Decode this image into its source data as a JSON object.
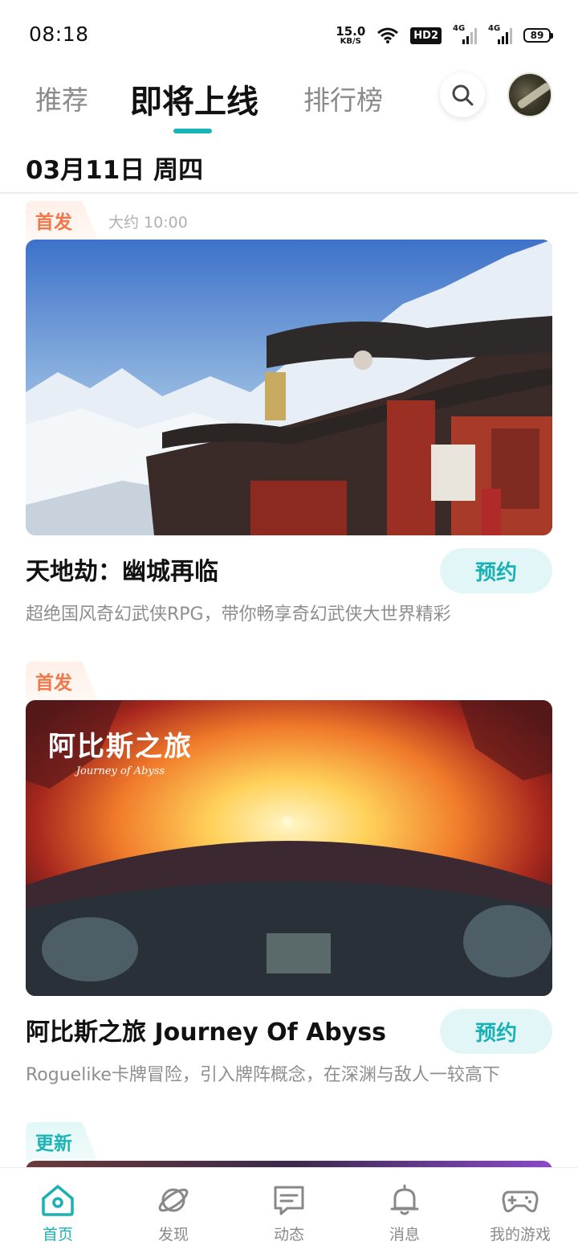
{
  "status_bar": {
    "time": "08:18",
    "net_speed_value": "15.0",
    "net_speed_unit": "KB/S",
    "hd_label": "HD2",
    "sig1_label": "4G",
    "sig2_label": "4G",
    "battery": "89"
  },
  "top_nav": {
    "tabs": [
      {
        "label": "推荐"
      },
      {
        "label": "即将上线"
      },
      {
        "label": "排行榜"
      }
    ],
    "active_tab": "即将上线"
  },
  "date_header": "03月11日 周四",
  "feed": [
    {
      "badge": "首发",
      "time_note": "大约 10:00",
      "title": "天地劫：幽城再临",
      "button": "预约",
      "description": "超绝国风奇幻武侠RPG，带你畅享奇幻武侠大世界精彩"
    },
    {
      "badge": "首发",
      "logo_text": "阿比斯之旅",
      "logo_subtext": "Journey of Abyss",
      "title": "阿比斯之旅 Journey Of Abyss",
      "button": "预约",
      "description": "Roguelike卡牌冒险，引入牌阵概念，在深渊与敌人一较高下"
    },
    {
      "badge": "更新"
    }
  ],
  "bottom_nav": {
    "items": [
      {
        "label": "首页",
        "icon": "home-icon"
      },
      {
        "label": "发现",
        "icon": "planet-icon"
      },
      {
        "label": "动态",
        "icon": "chat-icon"
      },
      {
        "label": "消息",
        "icon": "bell-icon"
      },
      {
        "label": "我的游戏",
        "icon": "gamepad-icon"
      }
    ],
    "active": "首页"
  },
  "colors": {
    "accent": "#19b1b4",
    "first_release": "#f0784b",
    "muted_text": "#8e8e8e"
  }
}
